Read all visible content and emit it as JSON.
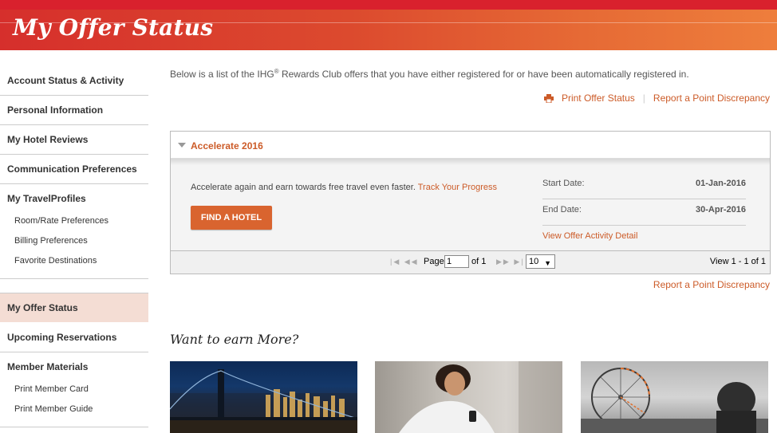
{
  "header": {
    "title": "My Offer Status"
  },
  "sidebar": {
    "items": [
      {
        "label": "Account Status & Activity"
      },
      {
        "label": "Personal Information"
      },
      {
        "label": "My Hotel Reviews"
      },
      {
        "label": "Communication Preferences"
      }
    ],
    "travel_profiles": {
      "label": "My TravelProfiles",
      "subitems": [
        "Room/Rate Preferences",
        "Billing Preferences",
        "Favorite Destinations"
      ]
    },
    "active_item": "My Offer Status",
    "upcoming": "Upcoming Reservations",
    "member_materials": {
      "label": "Member Materials",
      "subitems": [
        "Print Member Card",
        "Print Member Guide"
      ]
    }
  },
  "main": {
    "intro_before": "Below is a list of the IHG",
    "intro_sup": "®",
    "intro_after": " Rewards Club offers that you have either registered for or have been automatically registered in.",
    "print_link": "Print Offer Status",
    "separator": "|",
    "report_link": "Report a Point Discrepancy",
    "offer": {
      "name": "Accelerate 2016",
      "description": "Accelerate again and earn towards free travel even faster.",
      "track_link": "Track Your Progress",
      "button": "FIND A HOTEL",
      "start_label": "Start Date:",
      "start_value": "01-Jan-2016",
      "end_label": "End Date:",
      "end_value": "30-Apr-2016",
      "detail_link": "View Offer Activity Detail"
    },
    "pager": {
      "page_label": "Page",
      "page_value": "1",
      "of_label": "of 1",
      "rows_value": "10",
      "view_text": "View 1 - 1 of 1"
    },
    "report_link_bottom": "Report a Point Discrepancy",
    "earn_title": "Want to earn More?"
  },
  "colors": {
    "accent": "#cc5b28",
    "header_red": "#d62f2c",
    "active_bg": "#f4ddd4"
  }
}
